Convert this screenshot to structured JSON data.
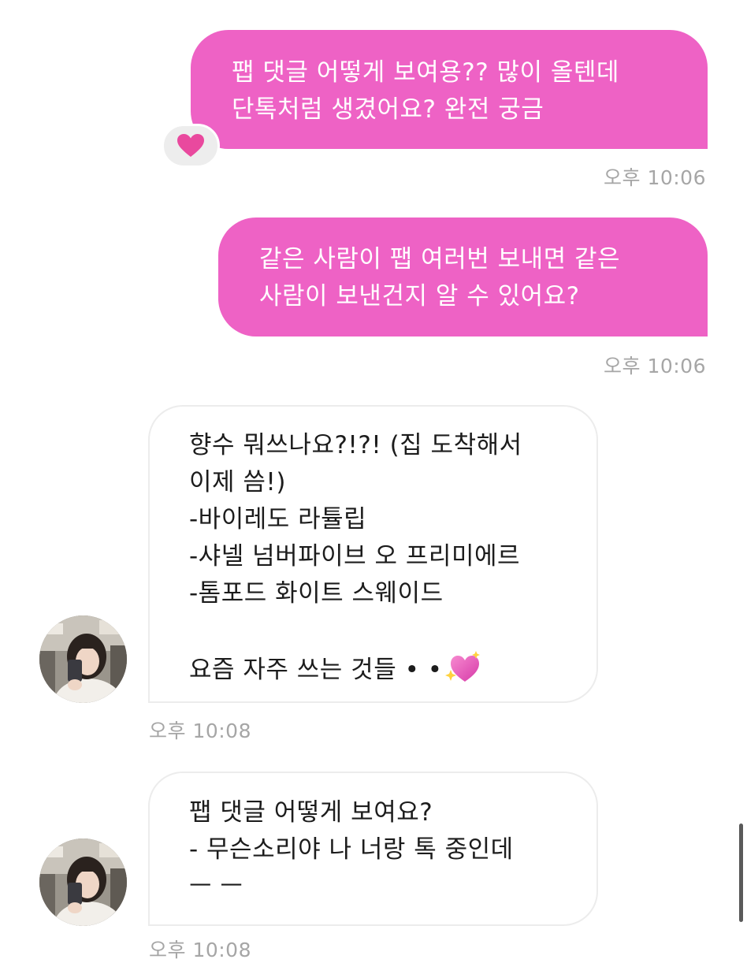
{
  "messages": [
    {
      "direction": "outgoing",
      "lines": [
        "팹 댓글 어떻게 보여용?? 많이 올텐데",
        "단톡처럼 생겼어요? 완전 궁금"
      ],
      "reaction": "heart-icon",
      "time": "오후 10:06"
    },
    {
      "direction": "outgoing",
      "lines": [
        "같은 사람이 팹 여러번 보내면 같은",
        "사람이 보낸건지 알 수 있어요?"
      ],
      "time": "오후 10:06"
    },
    {
      "direction": "incoming",
      "lines": [
        "향수 뭐쓰나요?!?! (집 도착해서",
        "이제 씀!)",
        "-바이레도 라튤립",
        "-샤넬 넘버파이브 오 프리미에르",
        "-톰포드 화이트 스웨이드",
        "",
        "요즘 자주 쓰는 것들 • •"
      ],
      "emoji": "sparkling-heart-icon",
      "time": "오후 10:08"
    },
    {
      "direction": "incoming",
      "lines": [
        "팹 댓글 어떻게 보여요?",
        "- 무슨소리야 나 너랑 톡 중인데",
        "ㅡ ㅡ"
      ],
      "time": "오후 10:08"
    }
  ],
  "colors": {
    "outgoing_bubble": "#ee62c5",
    "reaction_heart": "#e9499e",
    "timestamp": "#a6a6a6",
    "incoming_border": "#ececec"
  }
}
